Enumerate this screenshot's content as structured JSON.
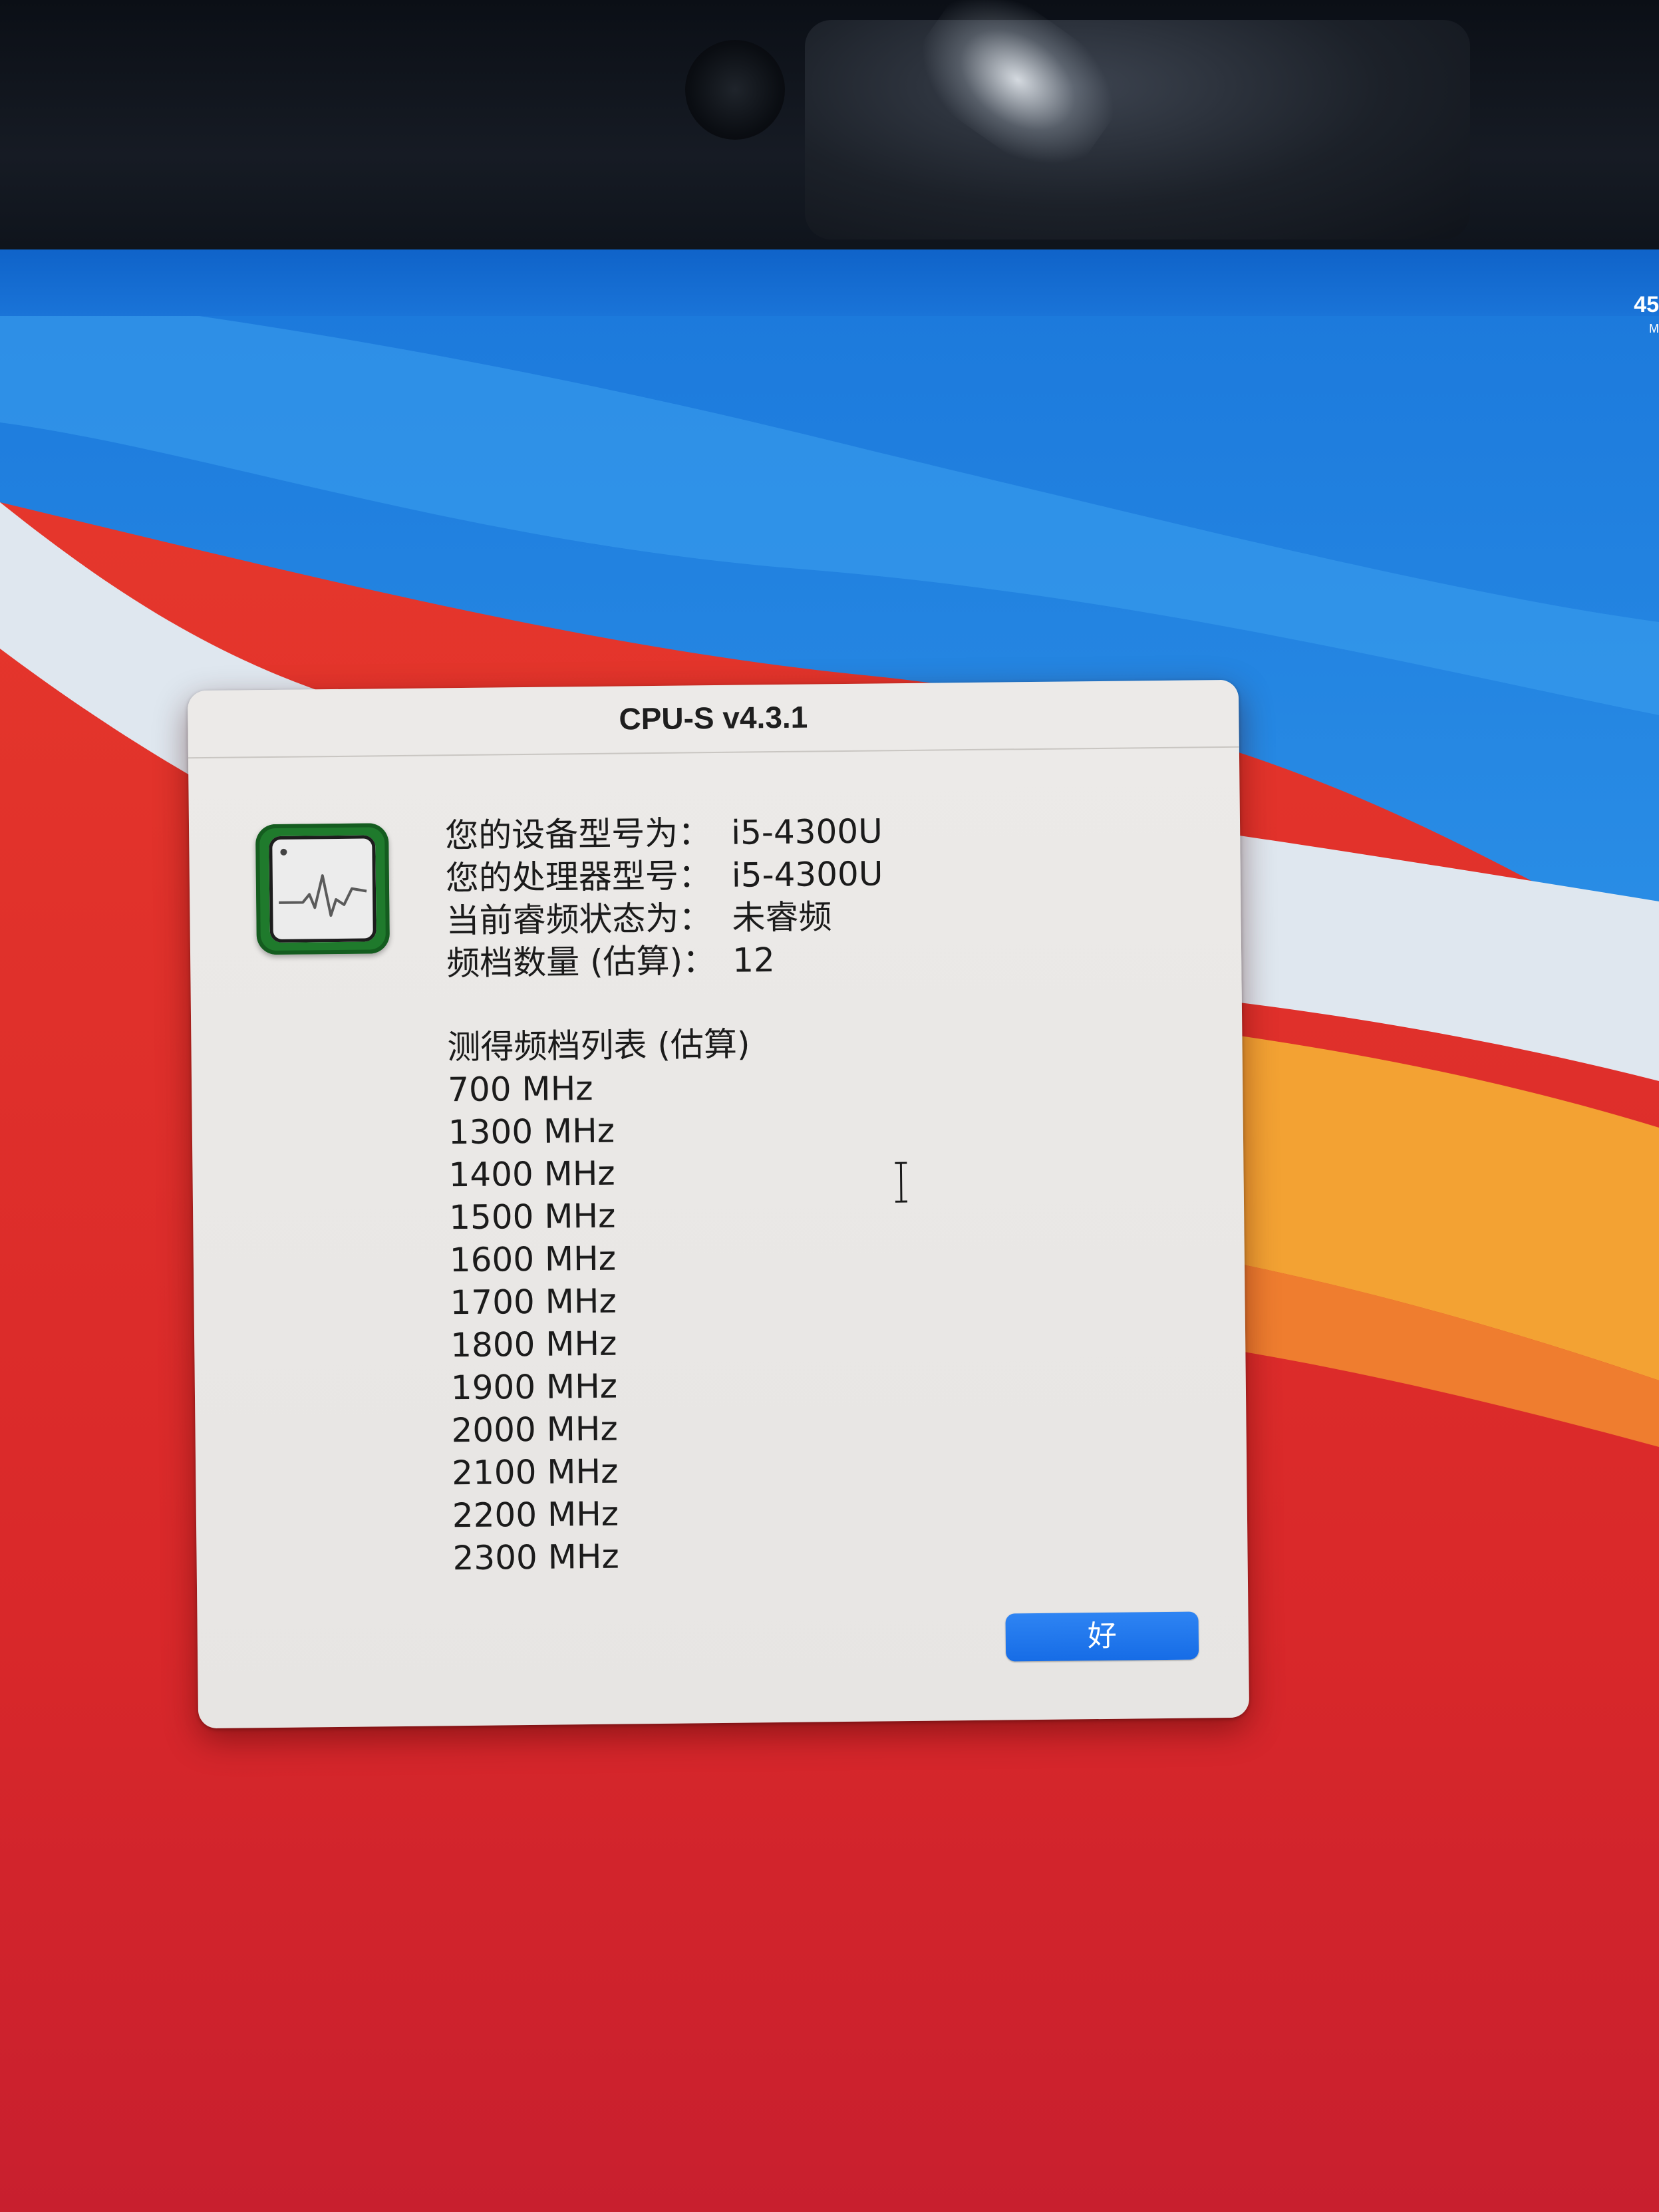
{
  "dialog": {
    "title": "CPU-S v4.3.1",
    "icon": "activity-monitor-icon",
    "info": [
      {
        "label": "您的设备型号为：",
        "value": "i5-4300U"
      },
      {
        "label": "您的处理器型号：",
        "value": "i5-4300U"
      },
      {
        "label": "当前睿频状态为：",
        "value": "未睿频"
      },
      {
        "label": "频档数量 (估算)：",
        "value": "12"
      }
    ],
    "freq_heading": "测得频档列表 (估算)",
    "frequencies": [
      "700 MHz",
      "1300 MHz",
      "1400 MHz",
      "1500 MHz",
      "1600 MHz",
      "1700 MHz",
      "1800 MHz",
      "1900 MHz",
      "2000 MHz",
      "2100 MHz",
      "2200 MHz",
      "2300 MHz"
    ],
    "ok_label": "好"
  },
  "colors": {
    "accent_button": "#1a6fe8",
    "icon_green": "#1f7a2c",
    "wallpaper_red": "#e8332a",
    "wallpaper_blue": "#1a74d8",
    "wallpaper_orange": "#f0a030"
  },
  "corner_clock": {
    "time": "45",
    "sub": "M"
  }
}
